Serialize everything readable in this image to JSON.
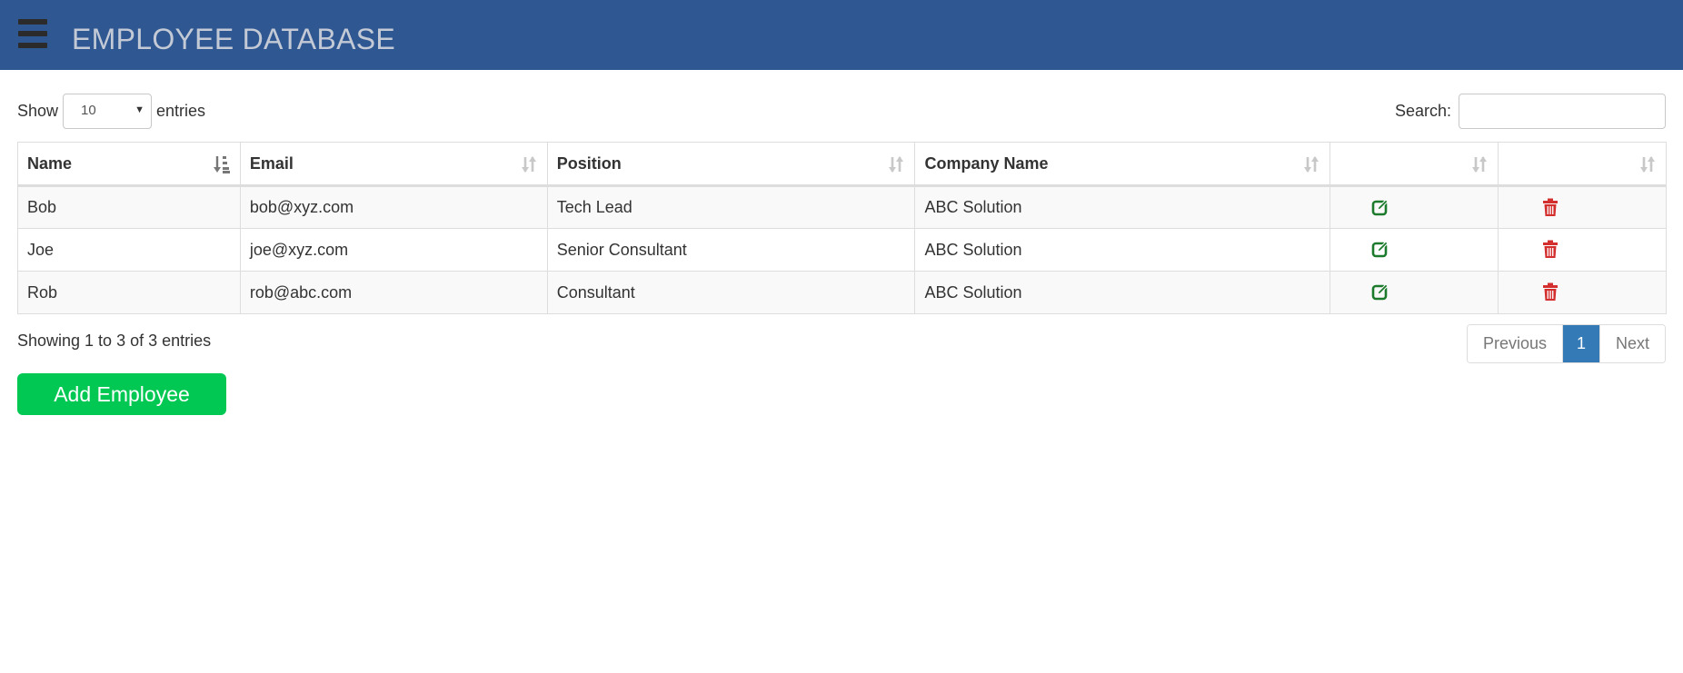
{
  "header": {
    "title": "EMPLOYEE DATABASE",
    "menu_icon": "hamburger-menu-icon"
  },
  "length": {
    "label_before": "Show",
    "value": "10",
    "label_after": "entries"
  },
  "search": {
    "label": "Search:",
    "value": "",
    "placeholder": ""
  },
  "table": {
    "columns": [
      "Name",
      "Email",
      "Position",
      "Company Name",
      "",
      ""
    ],
    "rows": [
      {
        "name": "Bob",
        "email": "bob@xyz.com",
        "position": "Tech Lead",
        "company": "ABC Solution"
      },
      {
        "name": "Joe",
        "email": "joe@xyz.com",
        "position": "Senior Consultant",
        "company": "ABC Solution"
      },
      {
        "name": "Rob",
        "email": "rob@abc.com",
        "position": "Consultant",
        "company": "ABC Solution"
      }
    ],
    "edit_icon": "edit-icon",
    "delete_icon": "trash-icon"
  },
  "info": "Showing 1 to 3 of 3 entries",
  "pagination": {
    "previous": "Previous",
    "current": "1",
    "next": "Next"
  },
  "add_button": "Add Employee",
  "colors": {
    "header_bg": "#2f5792",
    "header_text": "#c3cad6",
    "add_button_bg": "#00c853",
    "edit_icon": "#1b7a2b",
    "delete_icon": "#d32f2f",
    "pagination_active": "#337ab7"
  }
}
